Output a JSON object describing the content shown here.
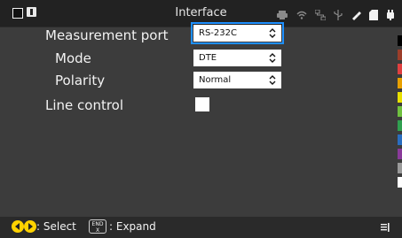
{
  "window": {
    "title": "Interface"
  },
  "settings": {
    "measurement_port": {
      "label": "Measurement port",
      "value": "RS-232C"
    },
    "mode": {
      "label": "Mode",
      "value": "DTE"
    },
    "polarity": {
      "label": "Polarity",
      "value": "Normal"
    },
    "line_control": {
      "label": "Line control",
      "checked": false
    }
  },
  "footer": {
    "select_hint": ": Select",
    "end_key": {
      "line1": "END",
      "line2": "X"
    },
    "expand_hint": ": Expand"
  },
  "status_icons": [
    "printer-icon",
    "wifi-icon",
    "network-icon",
    "usb-icon",
    "brush-icon",
    "sd-card-icon",
    "power-icon"
  ],
  "swatches": [
    "#000000",
    "#9c3e2a",
    "#e04040",
    "#e8a000",
    "#e8e000",
    "#70c040",
    "#30a050",
    "#2a6ec0",
    "#8a3a9a",
    "#9a9a9a",
    "#ffffff"
  ]
}
